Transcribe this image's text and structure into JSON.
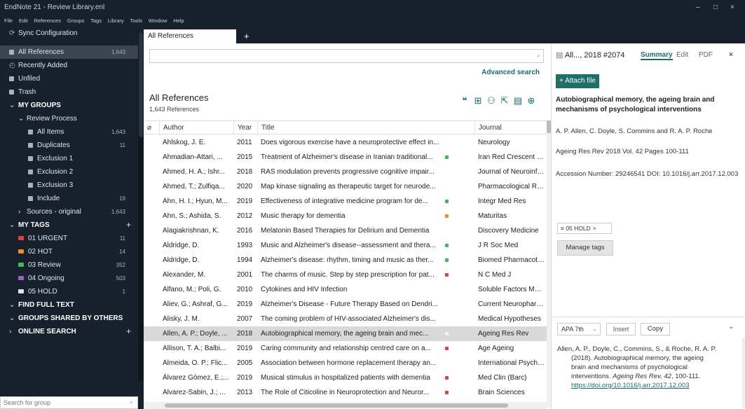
{
  "window": {
    "title": "EndNote 21 - Review Library.enl",
    "minimize": "–",
    "maximize": "□",
    "close": "×"
  },
  "menu": [
    "File",
    "Edit",
    "References",
    "Groups",
    "Tags",
    "Library",
    "Tools",
    "Window",
    "Help"
  ],
  "sidebar": {
    "sync": "Sync Configuration",
    "all_refs": {
      "label": "All References",
      "count": "1,643"
    },
    "recently_added": "Recently Added",
    "unfiled": "Unfiled",
    "trash": "Trash",
    "my_groups": "MY GROUPS",
    "review_process": "Review Process",
    "groups": [
      {
        "label": "All Items",
        "count": "1,643"
      },
      {
        "label": "Duplicates",
        "count": "11"
      },
      {
        "label": "Exclusion 1",
        "count": ""
      },
      {
        "label": "Exclusion 2",
        "count": ""
      },
      {
        "label": "Exclusion 3",
        "count": ""
      },
      {
        "label": "Include",
        "count": "19"
      }
    ],
    "sources": {
      "label": "Sources - original",
      "count": "1,643"
    },
    "my_tags": "MY TAGS",
    "tags": [
      {
        "label": "01 URGENT",
        "count": "11",
        "color": "#e0403f"
      },
      {
        "label": "02 HOT",
        "count": "14",
        "color": "#f08c2a"
      },
      {
        "label": "03 Review",
        "count": "352",
        "color": "#3cba54"
      },
      {
        "label": "04 Ongoing",
        "count": "503",
        "color": "#a05cc8"
      },
      {
        "label": "05 HOLD",
        "count": "1",
        "color": "#dfe5ec"
      }
    ],
    "find_full_text": "FIND FULL TEXT",
    "groups_shared": "GROUPS SHARED BY OTHERS",
    "online_search": "ONLINE SEARCH",
    "search_placeholder": "Search for group"
  },
  "tabs": {
    "active": "All References",
    "add": "+"
  },
  "main": {
    "title": "All References",
    "count": "1,643 References",
    "advanced_search": "Advanced search",
    "columns": [
      "Author",
      "Year",
      "Title",
      "Journal"
    ],
    "rows": [
      {
        "author": "Ahlskog, J. E.",
        "year": "2011",
        "title": "Does vigorous exercise have a neuroprotective effect in...",
        "journal": "Neurology",
        "tag": ""
      },
      {
        "author": "Ahmadian-Attari, ...",
        "year": "2015",
        "title": "Treatment of Alzheimer's disease in Iranian traditional...",
        "journal": "Iran Red Crescent Med J",
        "tag": "#3cba54"
      },
      {
        "author": "Ahmed, H. A.; Ishr...",
        "year": "2018",
        "title": "RAS modulation prevents progressive cognitive impair...",
        "journal": "Journal of Neuroinflam...",
        "tag": ""
      },
      {
        "author": "Ahmed, T.; Zulfiqa...",
        "year": "2020",
        "title": "Map kinase signaling as therapeutic target for neurode...",
        "journal": "Pharmacological Resea...",
        "tag": ""
      },
      {
        "author": "Ahn, H. I.; Hyun, M...",
        "year": "2019",
        "title": "Effectiveness of integrative medicine program for de...",
        "journal": "Integr Med Res",
        "tag": "#3cba54"
      },
      {
        "author": "Ahn, S.; Ashida, S.",
        "year": "2012",
        "title": "Music therapy for dementia",
        "journal": "Maturitas",
        "tag": "#f08c2a"
      },
      {
        "author": "Alagiakrishnan, K.",
        "year": "2016",
        "title": "Melatonin Based Therapies for Delirium and Dementia",
        "journal": "Discovery Medicine",
        "tag": ""
      },
      {
        "author": "Aldridge, D.",
        "year": "1993",
        "title": "Music and Alzheimer's disease--assessment and thera...",
        "journal": "J R Soc Med",
        "tag": "#3cba54"
      },
      {
        "author": "Aldridge, D.",
        "year": "1994",
        "title": "Alzheimer's disease: rhythm, timing and music as ther...",
        "journal": "Biomed Pharmacother",
        "tag": "#3cba54"
      },
      {
        "author": "Alexander, M.",
        "year": "2001",
        "title": "The charms of music. Step by step prescription for pat...",
        "journal": "N C Med J",
        "tag": "#e0403f"
      },
      {
        "author": "Alfano, M.; Poli, G.",
        "year": "2010",
        "title": "Cytokines and HIV Infection",
        "journal": "Soluble Factors Mediati...",
        "tag": ""
      },
      {
        "author": "Aliev, G.; Ashraf, G...",
        "year": "2019",
        "title": "Alzheimer's Disease - Future Therapy Based on Dendri...",
        "journal": "Current Neuropharmac...",
        "tag": ""
      },
      {
        "author": "Alisky, J. M.",
        "year": "2007",
        "title": "The coming problem of HIV-associated Alzheimer's dis...",
        "journal": "Medical Hypotheses",
        "tag": ""
      },
      {
        "author": "Allen, A. P.; Doyle, ...",
        "year": "2018",
        "title": "Autobiographical memory, the ageing brain and mec...",
        "journal": "Ageing Res Rev",
        "tag": "#f0f0f0"
      },
      {
        "author": "Allison, T. A.; Balbi...",
        "year": "2019",
        "title": "Caring community and relationship centred care on a...",
        "journal": "Age Ageing",
        "tag": "#e0403f"
      },
      {
        "author": "Almeida, O. P.; Flic...",
        "year": "2005",
        "title": "Association between hormone replacement therapy an...",
        "journal": "International Psychoge...",
        "tag": ""
      },
      {
        "author": "Álvarez Gómez, E.;...",
        "year": "2019",
        "title": "Musical stimulus in hospitalized patients with dementia",
        "journal": "Med Clin (Barc)",
        "tag": "#e0403f"
      },
      {
        "author": "Alvarez-Sabin, J.; ...",
        "year": "2013",
        "title": "The Role of Citicoline in Neuroprotection and Neuror...",
        "journal": "Brain Sciences",
        "tag": "#e0403f"
      }
    ]
  },
  "detail": {
    "header": "All..., 2018 #2074",
    "tab_summary": "Summary",
    "tab_edit": "Edit",
    "tab_pdf": "PDF",
    "close": "×",
    "attach": "+ Attach file",
    "title": "Autobiographical memory, the ageing brain and mechanisms of psychological interventions",
    "authors": "A. P. Allen, C. Doyle, S. Commins and R. A. P. Roche",
    "journal": "Ageing Res Rev 2018 Vol. 42 Pages 100-111",
    "accession": "Accession Number: 29246541 DOI: 10.1016/j.arr.2017.12.003",
    "tag_chip": "05 HOLD",
    "manage_tags": "Manage tags",
    "style": "APA 7th",
    "insert": "Insert",
    "copy": "Copy",
    "citation_line1": "Allen, A. P., Doyle, C., Commins, S., & Roche, R. A. P.",
    "citation_line2": "(2018). Autobiographical memory, the ageing",
    "citation_line3": "brain and mechanisms of psychological",
    "citation_line4a": "interventions. ",
    "citation_line4b": "Ageing Res Rev, 42",
    "citation_line4c": ", 100-111.",
    "citation_doi": "https://doi.org/10.1016/j.arr.2017.12.003"
  }
}
